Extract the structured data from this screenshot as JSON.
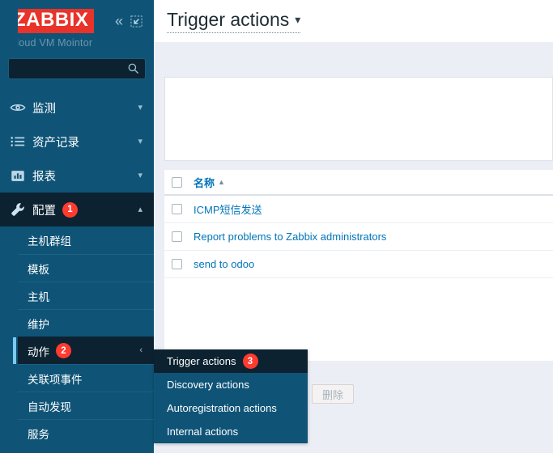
{
  "sidebar": {
    "logo_text": "ZABBIX",
    "subtitle": "Cloud VM Mointor",
    "collapse_icon": "chevron-double-left-icon",
    "compact_icon": "collapse-pane-icon",
    "search": {
      "value": "",
      "placeholder": "",
      "icon": "search-icon"
    },
    "nav": [
      {
        "label": "监测",
        "icon": "eye-icon",
        "arrow": "chevron-down-icon",
        "badge": ""
      },
      {
        "label": "资产记录",
        "icon": "list-icon",
        "arrow": "chevron-down-icon",
        "badge": ""
      },
      {
        "label": "报表",
        "icon": "bar-chart-icon",
        "arrow": "chevron-down-icon",
        "badge": ""
      },
      {
        "label": "配置",
        "icon": "wrench-icon",
        "arrow": "chevron-up-icon",
        "badge": "1"
      }
    ],
    "submenu": [
      {
        "label": "主机群组",
        "badge": "",
        "arrow": ""
      },
      {
        "label": "模板",
        "badge": "",
        "arrow": ""
      },
      {
        "label": "主机",
        "badge": "",
        "arrow": ""
      },
      {
        "label": "维护",
        "badge": "",
        "arrow": ""
      },
      {
        "label": "动作",
        "badge": "2",
        "arrow": "chevron-left-icon"
      },
      {
        "label": "关联项事件",
        "badge": "",
        "arrow": ""
      },
      {
        "label": "自动发现",
        "badge": "",
        "arrow": ""
      },
      {
        "label": "服务",
        "badge": "",
        "arrow": ""
      }
    ]
  },
  "flyout": {
    "items": [
      {
        "label": "Trigger actions",
        "badge": "3"
      },
      {
        "label": "Discovery actions",
        "badge": ""
      },
      {
        "label": "Autoregistration actions",
        "badge": ""
      },
      {
        "label": "Internal actions",
        "badge": ""
      }
    ]
  },
  "main": {
    "title": "Trigger actions",
    "title_chevron": "chevron-down-icon",
    "table": {
      "header": {
        "name": "名称",
        "sort": "▲"
      },
      "rows": [
        {
          "name": "ICMP短信发送"
        },
        {
          "name": "Report problems to Zabbix administrators"
        },
        {
          "name": "send to odoo"
        }
      ]
    },
    "delete_label": "删除"
  },
  "colors": {
    "sidebar_bg": "#0f5477",
    "sidebar_active": "#0c2231",
    "brand_red": "#e8332a",
    "badge_red": "#ff3a2f",
    "link_blue": "#0275b8",
    "accent_indicator": "#7cc9f0"
  }
}
